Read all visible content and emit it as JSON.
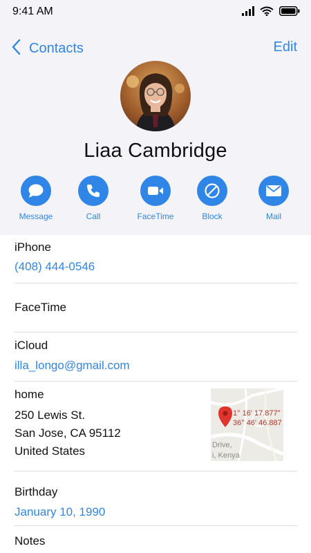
{
  "status": {
    "time": "9:41 AM"
  },
  "nav": {
    "back_label": "Contacts",
    "edit_label": "Edit"
  },
  "contact": {
    "name": "Liaa Cambridge"
  },
  "actions": [
    {
      "label": "Message",
      "icon": "message-icon"
    },
    {
      "label": "Call",
      "icon": "phone-icon"
    },
    {
      "label": "FaceTime",
      "icon": "video-icon"
    },
    {
      "label": "Block",
      "icon": "block-icon"
    },
    {
      "label": "Mail",
      "icon": "mail-icon"
    }
  ],
  "fields": {
    "phone": {
      "label": "iPhone",
      "value": "(408) 444-0546"
    },
    "facetime": {
      "label": "FaceTime"
    },
    "icloud": {
      "label": "iCloud",
      "value": "illa_longo@gmail.com"
    },
    "home": {
      "label": "home",
      "lines": [
        "250 Lewis St.",
        "San Jose, CA 95112",
        "United States"
      ],
      "map": {
        "coord1": "1° 16' 17.877\"",
        "coord2": "36° 46' 46.887",
        "place1": "Drive,",
        "place2": "i, Kenya"
      }
    },
    "birthday": {
      "label": "Birthday",
      "value": "January 10, 1990"
    },
    "notes": {
      "label": "Notes"
    }
  },
  "colors": {
    "accent": "#2f86e6",
    "header_bg": "#f3f3f8",
    "divider": "#dcdce0"
  }
}
